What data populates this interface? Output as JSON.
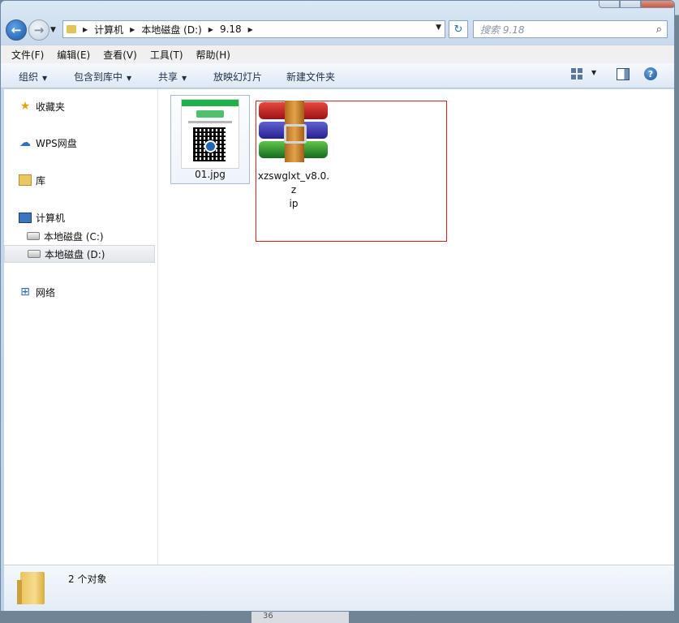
{
  "background": {
    "bottom_fragment": "36"
  },
  "nav": {
    "breadcrumbs": [
      "计算机",
      "本地磁盘 (D:)",
      "9.18"
    ],
    "search_placeholder": "搜索 9.18"
  },
  "menu": [
    "文件(F)",
    "编辑(E)",
    "查看(V)",
    "工具(T)",
    "帮助(H)"
  ],
  "toolbar": {
    "organize": "组织",
    "include_library": "包含到库中",
    "share": "共享",
    "slideshow": "放映幻灯片",
    "new_folder": "新建文件夹"
  },
  "sidebar": {
    "favorites": "收藏夹",
    "wps": "WPS网盘",
    "library": "库",
    "computer": "计算机",
    "drive_c": "本地磁盘 (C:)",
    "drive_d": "本地磁盘 (D:)",
    "network": "网络"
  },
  "files": [
    {
      "name": "01.jpg",
      "type": "image"
    },
    {
      "name": "xzswglxt_v8.0.zip",
      "line1": "xzswglxt_v8.0.z",
      "line2": "ip",
      "type": "archive"
    }
  ],
  "status": {
    "count": "2 个对象"
  },
  "colors": {
    "selection_border": "#e02020",
    "accent": "#1b55a6"
  }
}
